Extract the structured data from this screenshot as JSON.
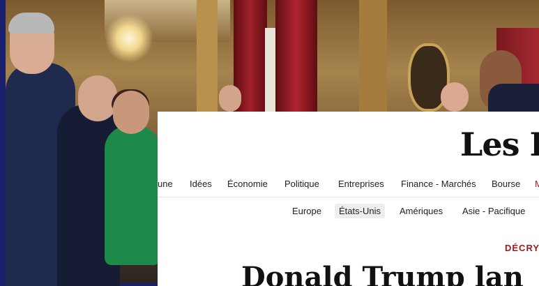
{
  "site": {
    "logo_text": "Les E"
  },
  "nav": {
    "items": [
      {
        "label": "une"
      },
      {
        "label": "Idées"
      },
      {
        "label": "Économie"
      },
      {
        "label": "Politique"
      },
      {
        "label": "Entreprises"
      },
      {
        "label": "Finance - Marchés"
      },
      {
        "label": "Bourse"
      },
      {
        "label": "M"
      }
    ]
  },
  "subnav": {
    "items": [
      {
        "label": "Europe"
      },
      {
        "label": "États-Unis",
        "active": true
      },
      {
        "label": "Amériques"
      },
      {
        "label": "Asie - Pacifique"
      }
    ]
  },
  "article": {
    "kicker": "DÉCRY",
    "headline": "Donald Trump lan"
  },
  "colors": {
    "accent_red": "#a11a1a",
    "photo_frame_blue": "#1a1f6b"
  }
}
